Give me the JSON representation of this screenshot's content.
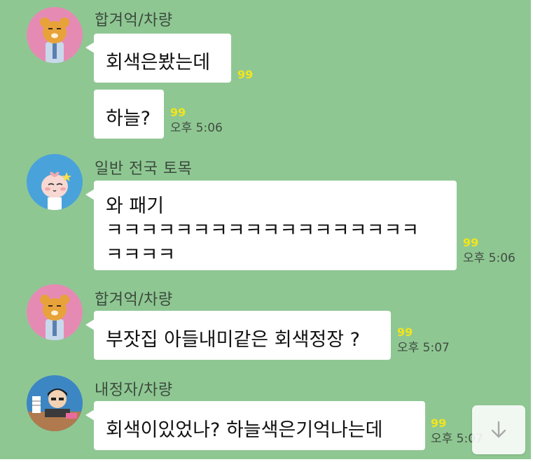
{
  "messages": [
    {
      "sender": "합겨억/차량",
      "avatar": "ryan-icon",
      "bubbles": [
        {
          "text": "회색은봤는데",
          "unread": "99",
          "time": ""
        },
        {
          "text": "하늘?",
          "unread": "99",
          "time": "오후 5:06"
        }
      ]
    },
    {
      "sender": "일반 전국 토목",
      "avatar": "apeach-icon",
      "bubbles": [
        {
          "lines": [
            "와 패기",
            "ㅋㅋㅋㅋㅋㅋㅋㅋㅋㅋㅋㅋㅋㅋㅋㅋㅋㅋ",
            "ㅋㅋㅋㅋ"
          ],
          "unread": "99",
          "time": "오후 5:06"
        }
      ]
    },
    {
      "sender": "합겨억/차량",
      "avatar": "ryan-icon",
      "bubbles": [
        {
          "text": "부잣집 아들내미같은 회색정장 ?",
          "unread": "99",
          "time": "오후 5:07"
        }
      ]
    },
    {
      "sender": "내정자/차량",
      "avatar": "office-worker-icon",
      "bubbles": [
        {
          "text": "회색이있었나?  하늘색은기억나는데",
          "unread": "99",
          "time": "오후 5:07"
        }
      ]
    }
  ],
  "scroll_button": {
    "icon": "arrow-down-icon"
  },
  "colors": {
    "chat_background": "#8fc793",
    "bubble": "#ffffff",
    "unread_badge": "#f2e51b",
    "ryan_avatar_bg": "#e58bb3",
    "apeach_avatar_bg": "#4aa2db",
    "worker_avatar_bg": "#3d86c4"
  }
}
